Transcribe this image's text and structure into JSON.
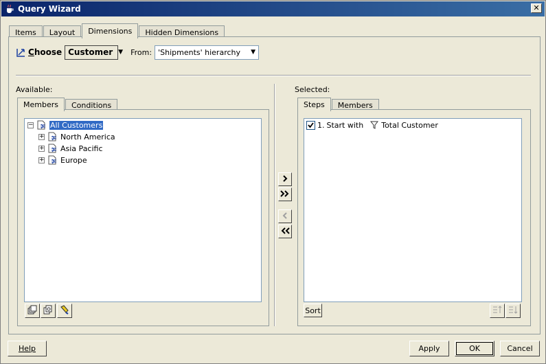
{
  "window": {
    "title": "Query Wizard"
  },
  "main_tabs": [
    "Items",
    "Layout",
    "Dimensions",
    "Hidden Dimensions"
  ],
  "choose": {
    "label": "Choose",
    "dimension_value": "Customer",
    "from_label": "From:",
    "hierarchy_value": "'Shipments' hierarchy"
  },
  "available": {
    "label": "Available:",
    "tabs": [
      "Members",
      "Conditions"
    ],
    "tree": [
      {
        "label": "All Customers",
        "expander": "−",
        "selected": true
      },
      {
        "label": "North America",
        "expander": "+"
      },
      {
        "label": "Asia Pacific",
        "expander": "+"
      },
      {
        "label": "Europe",
        "expander": "+"
      }
    ]
  },
  "selected": {
    "label": "Selected:",
    "tabs": [
      "Steps",
      "Members"
    ],
    "steps": [
      {
        "number": "1.",
        "text": "Start with",
        "target": "Total Customer",
        "checked": true
      }
    ],
    "sort_label": "Sort"
  },
  "buttons": {
    "help": "Help",
    "apply": "Apply",
    "ok": "OK",
    "cancel": "Cancel"
  },
  "icons": {
    "app": "java-cup-icon",
    "choose": "dimension-icon",
    "node": "hierarchy-member-icon",
    "filter": "funnel-icon"
  },
  "colors": {
    "titlebar": "#0a246a",
    "selection": "#316ac5",
    "face": "#ece9d8"
  }
}
